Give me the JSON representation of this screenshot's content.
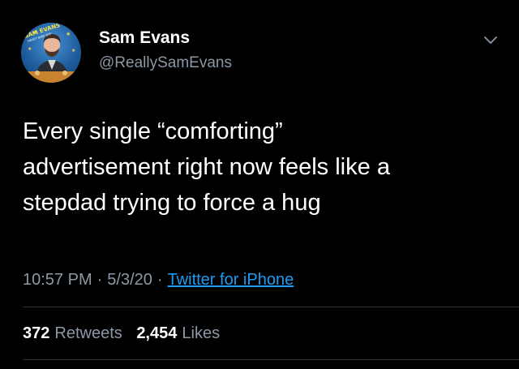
{
  "user": {
    "display_name": "Sam Evans",
    "handle": "@ReallySamEvans",
    "avatar_icon": "profile-photo",
    "avatar_badge_text": "SAM EVANS",
    "avatar_badge_subtext": "SWEET BABY BOY"
  },
  "tweet": {
    "text": "Every single “comforting”\nadvertisement right now feels like a\nstepdad trying to force a hug",
    "time": "10:57 PM",
    "date": "5/3/20",
    "separator": "·",
    "source": "Twitter for iPhone"
  },
  "stats": {
    "retweets_count": "372",
    "retweets_label": "Retweets",
    "likes_count": "2,454",
    "likes_label": "Likes"
  },
  "icons": {
    "more": "chevron-down-icon"
  },
  "colors": {
    "background": "#000000",
    "primary_text": "#ffffff",
    "secondary_text": "#8b98a5",
    "link": "#1d9bf0",
    "divider": "#2f3336"
  }
}
